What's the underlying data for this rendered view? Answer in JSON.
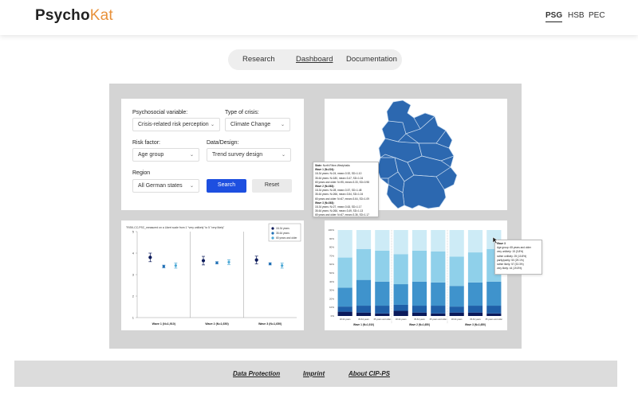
{
  "header": {
    "brand_part1": "Psycho",
    "brand_part2": "Kat",
    "projects": [
      "PSG",
      "HSB",
      "PEC"
    ]
  },
  "nav": {
    "tabs": [
      "Research",
      "Dashboard",
      "Documentation"
    ],
    "active": "Dashboard"
  },
  "filters": {
    "psychosocial_label": "Psychosocial variable:",
    "psychosocial_value": "Crisis-related risk perception",
    "crisis_label": "Type of crisis:",
    "crisis_value": "Climate Change",
    "risk_label": "Risk factor:",
    "risk_value": "Age group",
    "data_label": "Data/Design:",
    "data_value": "Trend survey design",
    "region_label": "Region",
    "region_value": "All German states",
    "search_label": "Search",
    "reset_label": "Reset"
  },
  "map_tooltip": {
    "state_key": "State:",
    "state": "North Rhine-Westphalia",
    "waves": [
      {
        "title": "Wave 1 (N=224):",
        "lines": [
          "18-34 years: N=24, mean=3.92, SD=1.10",
          "35-64 years: N=180, mean=3.47, SD=1.04",
          "65 years and older: N=95, mean=3.33, SD=0.98"
        ]
      },
      {
        "title": "Wave 2 (N=363):",
        "lines": [
          "18-34 years: N=28, mean=3.57, SD=1.48",
          "35-64 years: N=266, mean=3.54, SD=1.04",
          "65 years and older: N=67, mean=3.64, SD=1.09"
        ]
      },
      {
        "title": "Wave 3 (N=363):",
        "lines": [
          "18-34 years: N=27, mean=3.63, SD=1.17",
          "35-64 years: N=266, mean=3.49, SD=1.13",
          "65 years and older: N=67, mean=3.36, SD=1.17"
        ]
      }
    ]
  },
  "chart_data": [
    {
      "type": "scatter",
      "title": "\"RISK-CC-PSC_measured on a Likert scale from 1 \"very unlikely\" to 5 \"very likely\"",
      "categories": [
        "Wave 1 (N=1,910)",
        "Wave 2 (N=1,650)",
        "Wave 3 (N=1,650)"
      ],
      "series": [
        {
          "name": "18-34 years",
          "color": "#0b1a5b",
          "values": [
            3.8,
            3.65,
            3.68
          ],
          "err": [
            0.2,
            0.2,
            0.18
          ]
        },
        {
          "name": "35-64 years",
          "color": "#1f6fb5",
          "values": [
            3.38,
            3.55,
            3.5
          ],
          "err": [
            0.06,
            0.05,
            0.05
          ]
        },
        {
          "name": "65 years and older",
          "color": "#4ba8d6",
          "values": [
            3.42,
            3.58,
            3.42
          ],
          "err": [
            0.12,
            0.11,
            0.12
          ]
        }
      ],
      "yticks": [
        1,
        2,
        3,
        4,
        5
      ],
      "ylim": [
        1,
        5
      ],
      "legend_position": "top-right"
    },
    {
      "type": "bar",
      "stacked": true,
      "yticks": [
        "0%",
        "10%",
        "20%",
        "30%",
        "40%",
        "50%",
        "60%",
        "70%",
        "80%",
        "90%",
        "100%"
      ],
      "groups": [
        "Wave 1 (N=1,910)",
        "Wave 2 (N=1,650)",
        "Wave 3 (N=1,650)"
      ],
      "categories": [
        "18-34 years",
        "35-64 years",
        "65 years and older",
        "18-34 years",
        "35-64 years",
        "65 years and older",
        "18-34 years",
        "35-64 years",
        "65 years and older"
      ],
      "series": [
        {
          "name": "very unlikely",
          "color": "#0b1a5b",
          "values": [
            5,
            4,
            3,
            6,
            4,
            3,
            4,
            4,
            3
          ]
        },
        {
          "name": "rather unlikely",
          "color": "#1f5fa8",
          "values": [
            6,
            8,
            9,
            7,
            8,
            9,
            7,
            8,
            9
          ]
        },
        {
          "name": "partly/partly",
          "color": "#3f93cc",
          "values": [
            22,
            30,
            28,
            24,
            28,
            27,
            24,
            27,
            28
          ]
        },
        {
          "name": "rather likely",
          "color": "#8fd0ea",
          "values": [
            35,
            36,
            36,
            35,
            36,
            36,
            34,
            35,
            38
          ]
        },
        {
          "name": "very likely",
          "color": "#cdebf6",
          "values": [
            32,
            22,
            24,
            28,
            24,
            25,
            31,
            26,
            22
          ]
        }
      ],
      "tooltip": {
        "title": "Wave 3",
        "lines": [
          "Age group: 65 years and older",
          "very unlikely: 15 (3.8%)",
          "rather unlikely: 25 (10.8%)",
          "partly/partly: 50 (29.1%)",
          "rather likely: 57 (33.3%)",
          "very likely: 44 (19.8%)"
        ]
      }
    }
  ],
  "footer": {
    "links": [
      "Data Protection",
      "Imprint",
      "About CIP-PS"
    ]
  }
}
